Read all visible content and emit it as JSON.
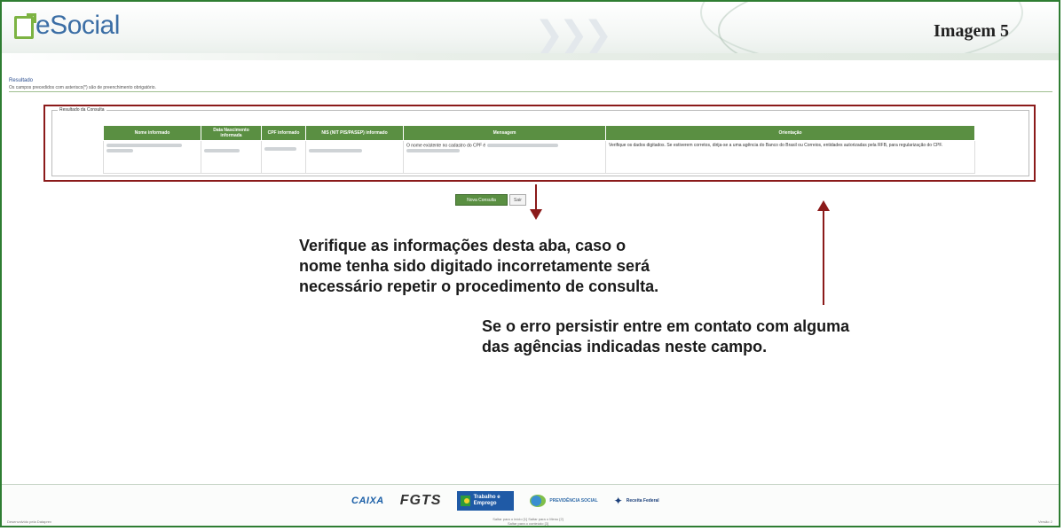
{
  "header": {
    "logo_text": "eSocial",
    "image_label": "Imagem 5"
  },
  "result": {
    "title": "Resultado",
    "note": "Os campos precedidos com asterisco(*) são de preenchimento obrigatório.",
    "legend": "Resultado da Consulta",
    "columns": [
      "Nome informado",
      "Data Nascimento informada",
      "CPF informado",
      "NIS (NIT PIS/PASEP) informado",
      "Mensagem",
      "Orientação"
    ],
    "row": {
      "mensagem": "O nome existente no cadastro do CPF é",
      "orientacao": "Verifique os dados digitados. Se estiverem corretos, dirija-se a uma agência do Banco do Brasil ou Correios, entidades autorizadas pela RFB, para regularização do CPF."
    }
  },
  "buttons": {
    "nova_consulta": "Nova Consulta",
    "sair": "Sair"
  },
  "callouts": {
    "first": [
      "Verifique as informações desta aba, caso o",
      "nome tenha sido digitado incorretamente será",
      "necessário repetir o procedimento de consulta."
    ],
    "second": [
      "Se o erro persistir entre em contato com alguma",
      "das agências indicadas neste campo."
    ]
  },
  "footer": {
    "left_text": "Desenvolvido pela Dataprev",
    "right_text": "Versão 2",
    "links": [
      "Saltar para o início [1]    Saltar para o Menu [2]",
      "Saltar para o conteúdo [3]"
    ],
    "logos": {
      "caixa": "CAIXA",
      "fgts": "FGTS",
      "mte": "Trabalho e Emprego",
      "previdencia": "PREVIDÊNCIA SOCIAL",
      "receita": "Receita Federal"
    }
  },
  "colors": {
    "brand_green": "#5a8f42",
    "highlight_red": "#8b1a1a",
    "logo_blue": "#3b6ea5"
  }
}
